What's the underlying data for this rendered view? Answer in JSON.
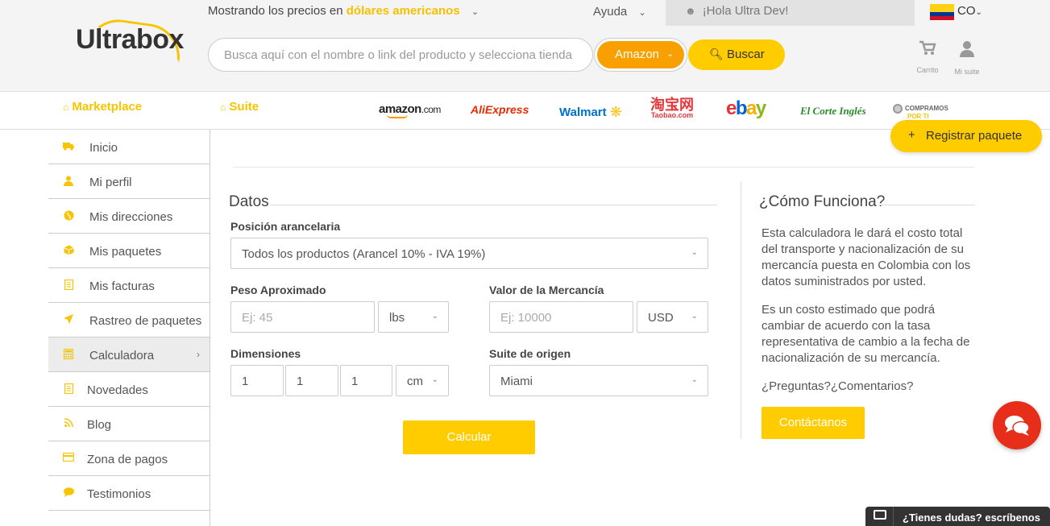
{
  "header": {
    "logo": "Ultrabox",
    "prices_text": "Mostrando los precios en",
    "currency": "dólares americanos",
    "help": "Ayuda",
    "greeting": "¡Hola Ultra Dev!",
    "country": "CO",
    "search_placeholder": "Busca aquí con el nombre o link del producto y selecciona tienda",
    "store_select": "Amazon",
    "search_button": "Buscar",
    "cart_label": "Carrito",
    "suite_label": "Mi suite"
  },
  "nav": {
    "marketplace": "Marketplace",
    "suite": "Suite",
    "stores": {
      "amazon": "amazon",
      "amazon_tld": ".com",
      "aliexpress": "AliExpress",
      "walmart": "Walmart",
      "taobao": "淘宝网",
      "taobao_sub": "Taobao.com",
      "ebay_e": "e",
      "ebay_b": "b",
      "ebay_a": "a",
      "ebay_y": "y",
      "elcorte": "El Corte Inglés",
      "compramos": "COMPRAMOS",
      "porti": "POR TI"
    },
    "register_button": "Registrar paquete"
  },
  "sidebar": {
    "items": [
      {
        "label": "Inicio",
        "icon": "truck-icon"
      },
      {
        "label": "Mi perfil",
        "icon": "user-icon"
      },
      {
        "label": "Mis direcciones",
        "icon": "globe-icon"
      },
      {
        "label": "Mis paquetes",
        "icon": "box-icon"
      },
      {
        "label": "Mis facturas",
        "icon": "document-icon"
      },
      {
        "label": "Rastreo de paquetes",
        "icon": "location-arrow-icon"
      },
      {
        "label": "Calculadora",
        "icon": "calculator-icon",
        "active": true
      },
      {
        "label": "Novedades",
        "icon": "document-icon"
      },
      {
        "label": "Blog",
        "icon": "rss-icon"
      },
      {
        "label": "Zona de pagos",
        "icon": "credit-card-icon"
      },
      {
        "label": "Testimonios",
        "icon": "comment-icon"
      }
    ]
  },
  "form": {
    "title": "Datos",
    "tariff_label": "Posición arancelaria",
    "tariff_value": "Todos los productos (Arancel 10% - IVA 19%)",
    "weight_label": "Peso Aproximado",
    "weight_placeholder": "Ej: 45",
    "weight_unit": "lbs",
    "value_label": "Valor de la Mercancía",
    "value_placeholder": "Ej: 10000",
    "value_currency": "USD",
    "dims_label": "Dimensiones",
    "dim1": "1",
    "dim2": "1",
    "dim3": "1",
    "dim_unit": "cm",
    "origin_label": "Suite de origen",
    "origin_value": "Miami",
    "calc_button": "Calcular"
  },
  "info": {
    "title": "¿Cómo Funciona?",
    "p1": "Esta calculadora le dará el costo total del transporte y nacionalización de su mercancía puesta en Colombia con los datos suministrados por usted.",
    "p2": "Es un costo estimado que podrá cambiar de acuerdo con la tasa representativa de cambio a la fecha de nacionalización de su mercancía.",
    "p3": "¿Preguntas?¿Comentarios?",
    "contact_button": "Contáctanos"
  },
  "chat": {
    "bar_text": "¿Tienes dudas? escríbenos"
  },
  "colors": {
    "accent": "#ffcc00",
    "amazon": "#f7a000",
    "chat": "#e62e1b"
  }
}
